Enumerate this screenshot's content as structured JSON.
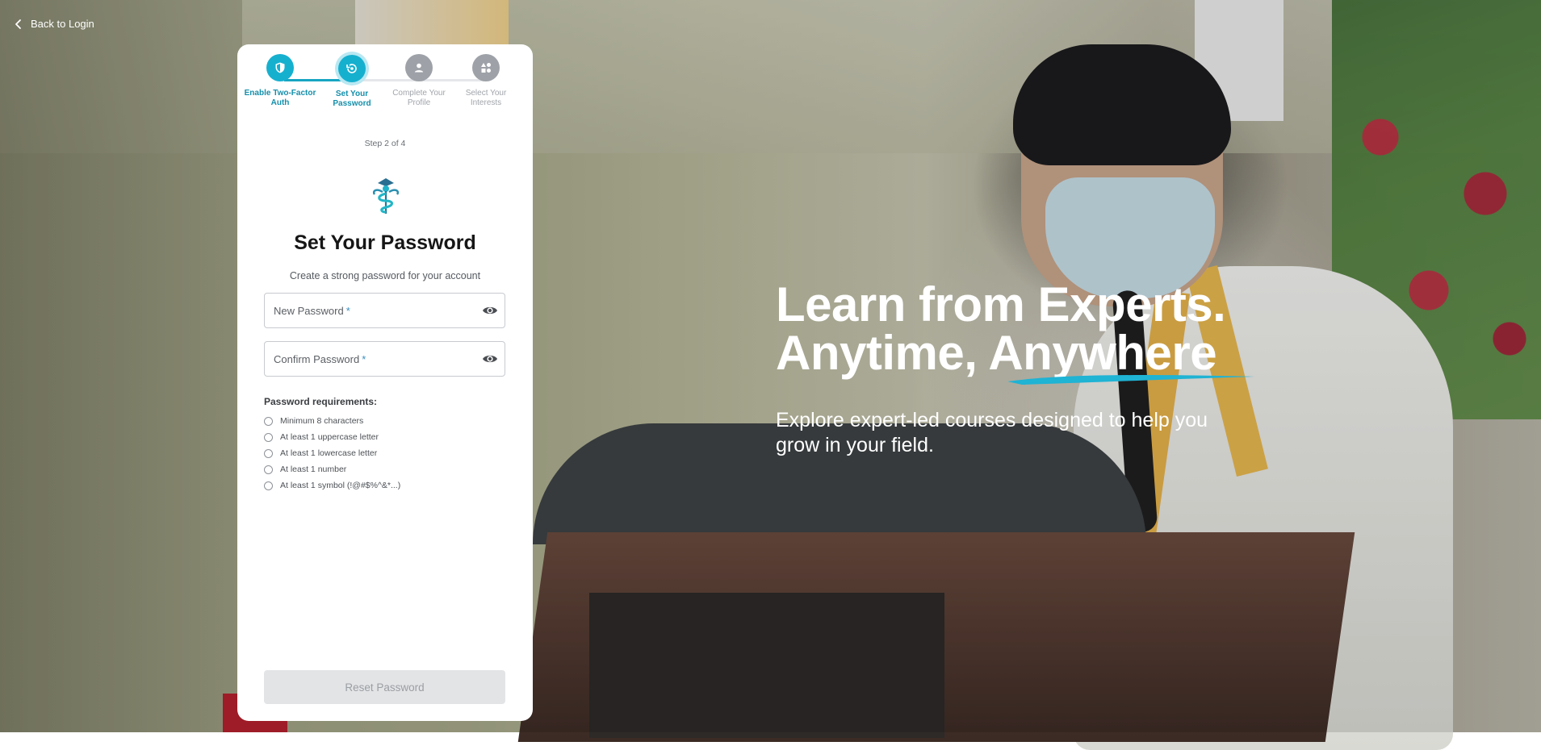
{
  "nav": {
    "back_label": "Back to Login"
  },
  "stepper": {
    "steps": [
      {
        "label": "Enable Two-Factor Auth",
        "state": "completed",
        "icon": "shield-icon"
      },
      {
        "label": "Set Your Password",
        "state": "current",
        "icon": "key-reset-icon"
      },
      {
        "label": "Complete Your Profile",
        "state": "pending",
        "icon": "person-icon"
      },
      {
        "label": "Select Your Interests",
        "state": "pending",
        "icon": "category-icon"
      }
    ],
    "step_count": "Step 2 of 4"
  },
  "form": {
    "title": "Set Your Password",
    "subtitle": "Create a strong password for your account",
    "new_password": {
      "label": "New Password",
      "required_mark": "*",
      "value": ""
    },
    "confirm_password": {
      "label": "Confirm Password",
      "required_mark": "*",
      "value": ""
    },
    "requirements_title": "Password requirements:",
    "requirements": [
      "Minimum 8 characters",
      "At least 1 uppercase letter",
      "At least 1 lowercase letter",
      "At least 1 number",
      "At least 1 symbol (!@#$%^&*...)"
    ],
    "submit_label": "Reset Password"
  },
  "hero": {
    "headline_line1": "Learn from Experts.",
    "headline_line2": "Anytime, Anywhere",
    "description": "Explore expert-led courses designed to help you grow in your field."
  },
  "colors": {
    "accent": "#16b0cf",
    "accent_dark": "#148fab",
    "pending": "#9ea2a8",
    "disabled_button": "#e3e4e6",
    "underline_brush": "#1fb3d4"
  }
}
